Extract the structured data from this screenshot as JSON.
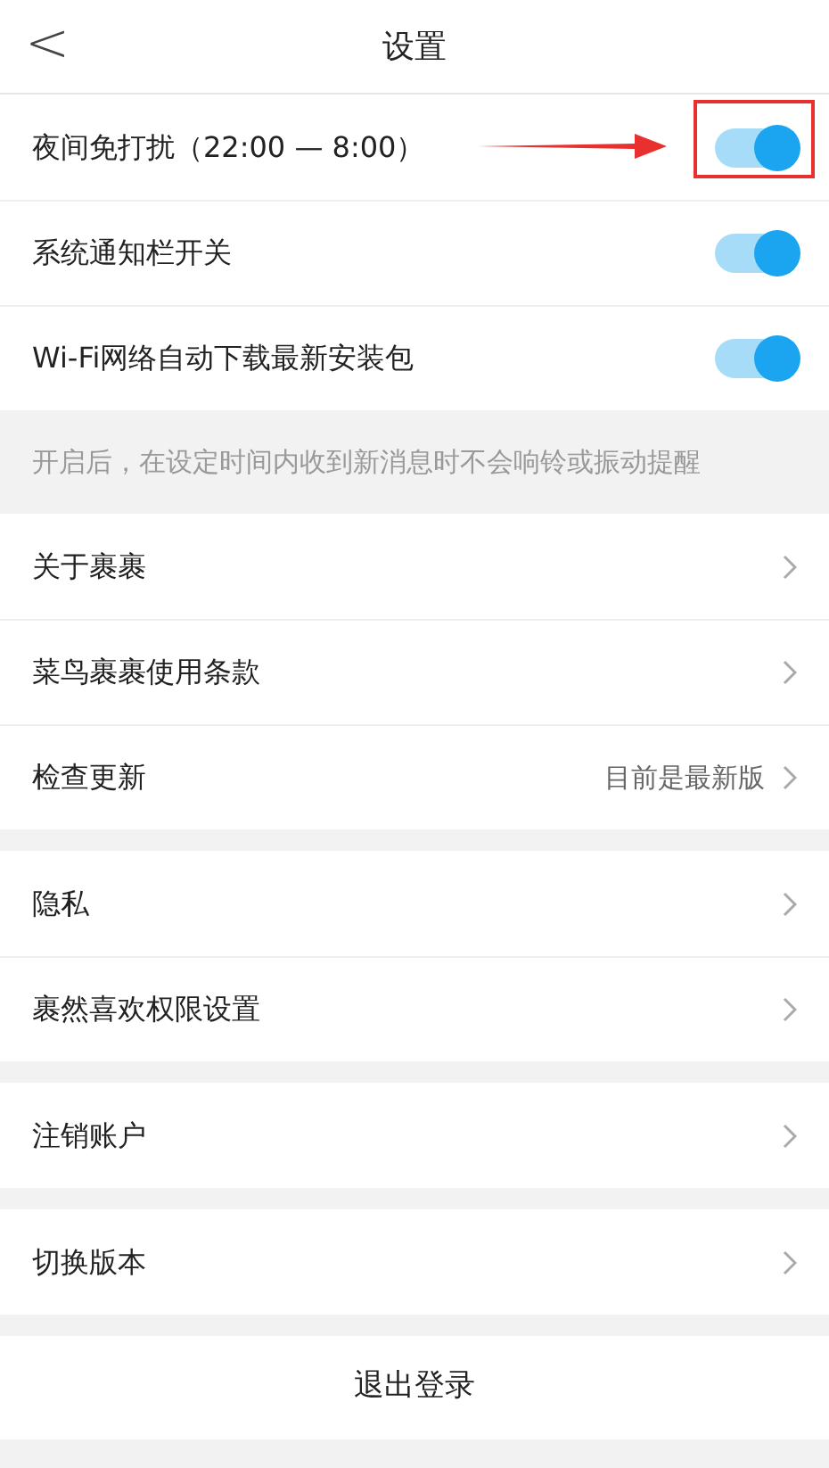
{
  "header": {
    "back": "<",
    "title": "设置"
  },
  "toggles": [
    {
      "label": "夜间免打扰（22:00 — 8:00）",
      "on": true,
      "highlighted": true
    },
    {
      "label": "系统通知栏开关",
      "on": true,
      "highlighted": false
    },
    {
      "label": "Wi-Fi网络自动下载最新安装包",
      "on": true,
      "highlighted": false
    }
  ],
  "note": "开启后，在设定时间内收到新消息时不会响铃或振动提醒",
  "groups": [
    [
      {
        "label": "关于裹裹"
      },
      {
        "label": "菜鸟裹裹使用条款"
      },
      {
        "label": "检查更新",
        "value": "目前是最新版"
      }
    ],
    [
      {
        "label": "隐私"
      },
      {
        "label": "裹然喜欢权限设置"
      }
    ],
    [
      {
        "label": "注销账户"
      }
    ],
    [
      {
        "label": "切换版本"
      }
    ]
  ],
  "logout": "退出登录"
}
